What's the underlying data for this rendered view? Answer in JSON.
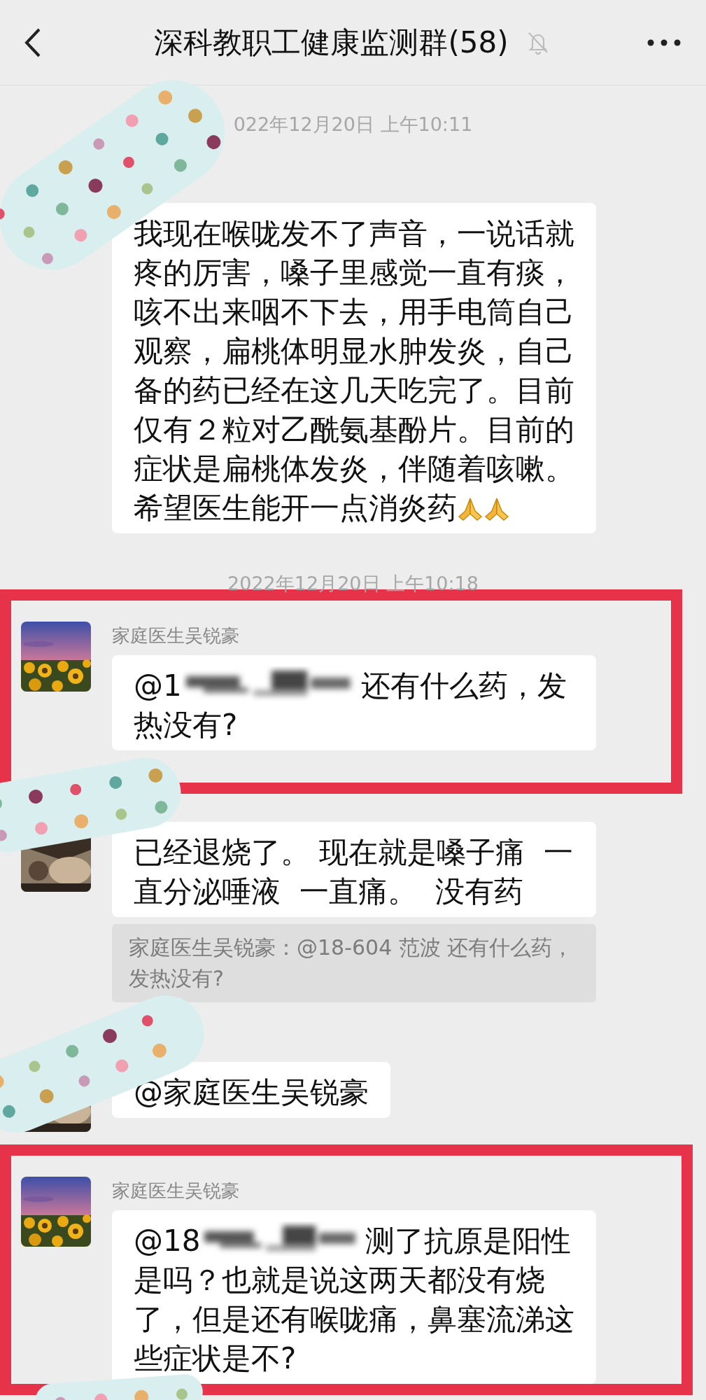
{
  "header": {
    "title": "深科教职工健康监测群(58)",
    "muted": true
  },
  "feed": [
    {
      "kind": "time",
      "text": "022年12月20日 上午10:11"
    },
    {
      "kind": "message",
      "avatar_visible": false,
      "highlighted": false,
      "text": "我现在喉咙发不了声音，一说话就疼的厉害，嗓子里感觉一直有痰，咳不出来咽不下去，用手电筒自己观察，扁桃体明显水肿发炎，自己备的药已经在这几天吃完了。目前仅有２粒对乙酰氨基酚片。目前的症状是扁桃体发炎，伴随着咳嗽。希望医生能开一点消炎药",
      "emoji": [
        {
          "kind": "pray"
        },
        {
          "kind": "pray"
        }
      ]
    },
    {
      "kind": "time",
      "text": "2022年12月20日 上午10:18"
    },
    {
      "kind": "message",
      "avatar_visible": true,
      "highlighted": true,
      "sender": "家庭医生吴锐豪",
      "mention": "@1",
      "masked": true,
      "text": "还有什么药，发热没有?"
    },
    {
      "kind": "message",
      "avatar_visible": true,
      "highlighted": false,
      "text": "已经退烧了。 现在就是嗓子痛  一直分泌唾液  一直痛。  没有药",
      "quote": "家庭医生吴锐豪：@18-604 范波 还有什么药，发热没有?"
    },
    {
      "kind": "message",
      "avatar_visible": true,
      "highlighted": false,
      "text": "@家庭医生吴锐豪"
    },
    {
      "kind": "message",
      "avatar_visible": true,
      "highlighted": true,
      "sender": "家庭医生吴锐豪",
      "mention": "@18",
      "masked": true,
      "text": "测了抗原是阳性是吗？也就是说这两天都没有烧了，但是还有喉咙痛，鼻塞流涕这些症状是不?"
    }
  ]
}
